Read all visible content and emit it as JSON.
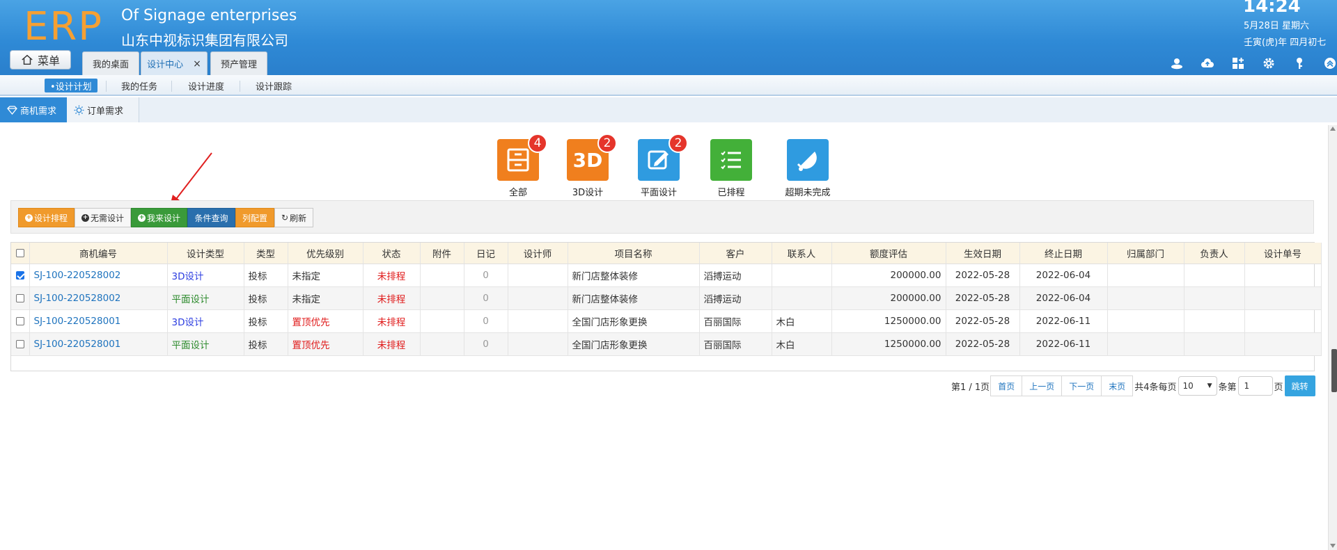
{
  "header": {
    "logo": "ERP",
    "brand_en": "Of Signage enterprises",
    "brand_cn": "山东中视标识集团有限公司",
    "time": "14:24",
    "date": "5月28日 星期六",
    "lunar": "壬寅(虎)年 四月初七",
    "menu_label": "菜单",
    "tabs": [
      {
        "label": "我的桌面"
      },
      {
        "label": "设计中心",
        "close": "×"
      },
      {
        "label": "预产管理"
      }
    ],
    "icons": [
      "user-icon",
      "cloud-upload-icon",
      "grid-add-icon",
      "gear-icon",
      "key-icon",
      "collapse-up-icon"
    ]
  },
  "subnav": {
    "items": [
      "•设计计划",
      "我的任务",
      "设计进度",
      "设计跟踪"
    ]
  },
  "left_tabs": [
    "商机需求",
    "订单需求"
  ],
  "categories": [
    {
      "label": "全部",
      "badge": "4",
      "color": "#f07f1e"
    },
    {
      "label": "3D设计",
      "badge": "2",
      "color": "#f07f1e",
      "glyph": "3D"
    },
    {
      "label": "平面设计",
      "badge": "2",
      "color": "#2f9be0"
    },
    {
      "label": "已排程",
      "badge": "",
      "color": "#43b039"
    },
    {
      "label": "超期未完成",
      "badge": "",
      "color": "#2f9be0"
    }
  ],
  "toolbar": {
    "schedule": "设计排程",
    "no_design": "无需设计",
    "i_design": "我来设计",
    "query": "条件查询",
    "columns": "列配置",
    "refresh": "刷新"
  },
  "table": {
    "columns": [
      "商机编号",
      "设计类型",
      "类型",
      "优先级别",
      "状态",
      "附件",
      "日记",
      "设计师",
      "项目名称",
      "客户",
      "联系人",
      "额度评估",
      "生效日期",
      "终止日期",
      "归属部门",
      "负责人",
      "设计单号"
    ],
    "rows": [
      {
        "checked": true,
        "id": "SJ-100-220528002",
        "design_type": "3D设计",
        "type": "投标",
        "priority": "未指定",
        "status": "未排程",
        "attach": "",
        "log": "0",
        "designer": "",
        "project": "新门店整体装修",
        "customer": "滔搏运动",
        "contact": "",
        "amount": "200000.00",
        "start": "2022-05-28",
        "end": "2022-06-04",
        "dept": "",
        "owner": "",
        "design_no": ""
      },
      {
        "checked": false,
        "id": "SJ-100-220528002",
        "design_type": "平面设计",
        "type": "投标",
        "priority": "未指定",
        "status": "未排程",
        "attach": "",
        "log": "0",
        "designer": "",
        "project": "新门店整体装修",
        "customer": "滔搏运动",
        "contact": "",
        "amount": "200000.00",
        "start": "2022-05-28",
        "end": "2022-06-04",
        "dept": "",
        "owner": "",
        "design_no": ""
      },
      {
        "checked": false,
        "id": "SJ-100-220528001",
        "design_type": "3D设计",
        "type": "投标",
        "priority": "置顶优先",
        "status": "未排程",
        "attach": "",
        "log": "0",
        "designer": "",
        "project": "全国门店形象更换",
        "customer": "百丽国际",
        "contact": "木白",
        "amount": "1250000.00",
        "start": "2022-05-28",
        "end": "2022-06-11",
        "dept": "",
        "owner": "",
        "design_no": ""
      },
      {
        "checked": false,
        "id": "SJ-100-220528001",
        "design_type": "平面设计",
        "type": "投标",
        "priority": "置顶优先",
        "status": "未排程",
        "attach": "",
        "log": "0",
        "designer": "",
        "project": "全国门店形象更换",
        "customer": "百丽国际",
        "contact": "木白",
        "amount": "1250000.00",
        "start": "2022-05-28",
        "end": "2022-06-11",
        "dept": "",
        "owner": "",
        "design_no": ""
      }
    ]
  },
  "pager": {
    "page_info": "第1 / 1页",
    "first": "首页",
    "prev": "上一页",
    "next": "下一页",
    "last": "末页",
    "total": "共4条每页",
    "page_size": "10",
    "per_label": "条第",
    "page_input": "1",
    "page_suffix": "页",
    "go": "跳转"
  },
  "colors": {
    "header_blue": "#2f8ad6",
    "orange": "#f0a030",
    "green": "#3a9a3a",
    "dark_blue": "#2a6fad",
    "red": "#e01b1b"
  }
}
